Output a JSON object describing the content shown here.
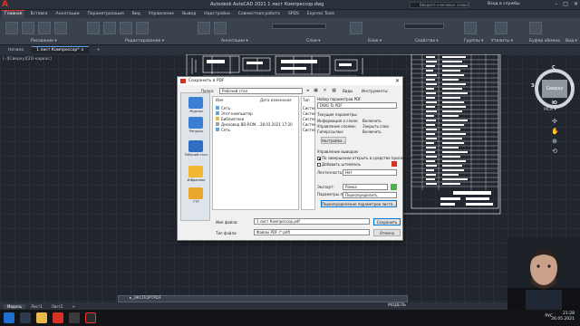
{
  "titlebar": {
    "title": "Autodesk AutoCAD 2021   1 лист Компрессор.dwg",
    "search_placeholder": "Введите ключевое слово/фразу",
    "login": "Вход в службы",
    "minimize": "–",
    "maximize": "□",
    "close": "✕"
  },
  "ribbon_tabs": [
    "Главная",
    "Вставка",
    "Аннотации",
    "Параметризация",
    "Вид",
    "Управление",
    "Вывод",
    "Надстройки",
    "Совместная работа",
    "SPDS",
    "Express Tools"
  ],
  "ribbon_groups": [
    {
      "label": "Рисование ▾"
    },
    {
      "label": "Редактирование ▾"
    },
    {
      "label": "Аннотации ▾"
    },
    {
      "label": "Слои ▾"
    },
    {
      "label": "Блок ▾"
    },
    {
      "label": "Свойства ▾"
    },
    {
      "label": "Группы ▾"
    },
    {
      "label": "Утилиты ▾"
    },
    {
      "label": "Буфер обмена"
    },
    {
      "label": "Вид ▾"
    }
  ],
  "doc_tabs": [
    {
      "label": "Начало"
    },
    {
      "label": "1 лист Компрессор*  ×"
    },
    {
      "label": "+"
    }
  ],
  "view_label": "[–][Сверху][2D-каркас]",
  "viewcube": {
    "face": "Сверху",
    "north": "С",
    "south": "Ю",
    "west": "З",
    "east": "В",
    "wcs": "МСК ▾"
  },
  "dialog": {
    "title": "Сохранить в PDF",
    "close": "✕",
    "folder_label": "Папка:",
    "folder_value": "Рабочий стол",
    "views_label": "Виды",
    "tools_label": "Инструменты",
    "places": [
      "Журнал",
      "Ресурсы",
      "Рабочий стол",
      "Избранное",
      "FTP"
    ],
    "col_name": "Имя",
    "col_date": "Дата изменения",
    "col_type": "Тип",
    "files": [
      {
        "name": "Сеть",
        "date": "",
        "type": "Систем"
      },
      {
        "name": "Этот компьютер",
        "date": "",
        "type": "Систем"
      },
      {
        "name": "Библиотеки",
        "date": "",
        "type": "Систем"
      },
      {
        "name": "Дисковод BD-ROM...",
        "date": "28.03.2021 17:20",
        "type": "Систем"
      },
      {
        "name": "Сеть",
        "date": "",
        "type": "Систем"
      }
    ],
    "pdf_section": "Набор параметров PDF",
    "pdf_preset": "DWG To PDF",
    "current_settings": "Текущие параметры:",
    "settings": [
      {
        "label": "Информация о слоях:",
        "value": "Включить"
      },
      {
        "label": "Управление слоями:",
        "value": "Закрыть слои"
      },
      {
        "label": "Гиперссылки:",
        "value": "Включить"
      }
    ],
    "options_button": "Настройка...",
    "output_section": "Управление выводом",
    "open_after": "По завершении открыть в средстве просмотра",
    "include_stamp": "Добавить штемпель",
    "multipage_label": "Ленточность:",
    "multipage_value": "Нет",
    "export_label": "Экспорт:",
    "export_value": "Рамка",
    "page_setup_label": "Параметры листа:",
    "page_setup_value": "Переопределить",
    "page_setup_button": "Переопределение параметров листа...",
    "filename_label": "Имя файла:",
    "filename_value": "1 лист Компрессор.pdf",
    "filetype_label": "Тип файла:",
    "filetype_value": "Файлы PDF (*.pdf)",
    "save_button": "Сохранить",
    "cancel_button": "Отмена"
  },
  "command_line": "▸_ЭКСПОРТPDF",
  "layout_tabs": [
    "Модель",
    "Лист1",
    "Лист2",
    "+"
  ],
  "status_model": "МОДЕЛЬ",
  "taskbar": {
    "lang": "РУС",
    "time": "21:28",
    "date": "26.05.2021"
  }
}
